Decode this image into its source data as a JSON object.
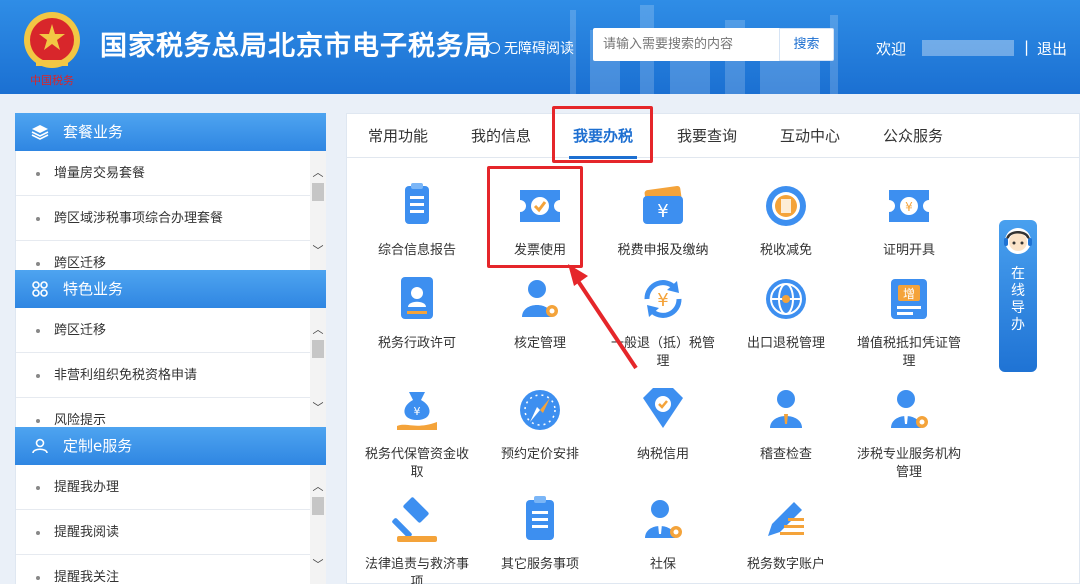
{
  "header": {
    "title": "国家税务总局北京市电子税务局",
    "emblem_caption": "中国税务",
    "accessible_label": "无障碍阅读",
    "search_placeholder": "请输入需要搜索的内容",
    "search_button": "搜索",
    "welcome": "欢迎",
    "separator": "|",
    "logout": "退出"
  },
  "sidebar": [
    {
      "title": "套餐业务",
      "icon": "layers-icon",
      "items": [
        "增量房交易套餐",
        "跨区域涉税事项综合办理套餐",
        "跨区迁移"
      ]
    },
    {
      "title": "特色业务",
      "icon": "grid-icon",
      "items": [
        "跨区迁移",
        "非营利组织免税资格申请",
        "风险提示"
      ]
    },
    {
      "title": "定制e服务",
      "icon": "user-icon",
      "items": [
        "提醒我办理",
        "提醒我阅读",
        "提醒我关注"
      ]
    }
  ],
  "tabs": [
    "常用功能",
    "我的信息",
    "我要办税",
    "我要查询",
    "互动中心",
    "公众服务"
  ],
  "active_tab": "我要办税",
  "services": [
    {
      "label": "综合信息报告",
      "icon": "document-list-icon"
    },
    {
      "label": "发票使用",
      "icon": "invoice-ticket-icon"
    },
    {
      "label": "税费申报及缴纳",
      "icon": "yuan-wallet-icon"
    },
    {
      "label": "税收减免",
      "icon": "tax-relief-icon"
    },
    {
      "label": "证明开具",
      "icon": "certificate-ticket-icon"
    },
    {
      "label": "税务行政许可",
      "icon": "id-card-icon"
    },
    {
      "label": "核定管理",
      "icon": "user-gear-icon"
    },
    {
      "label": "一般退（抵）税管理",
      "icon": "yuan-refresh-icon"
    },
    {
      "label": "出口退税管理",
      "icon": "globe-icon"
    },
    {
      "label": "增值税抵扣凭证管理",
      "icon": "vat-voucher-icon"
    },
    {
      "label": "税务代保管资金收取",
      "icon": "money-bag-hand-icon"
    },
    {
      "label": "预约定价安排",
      "icon": "compass-icon"
    },
    {
      "label": "纳税信用",
      "icon": "diamond-check-icon"
    },
    {
      "label": "稽查检查",
      "icon": "inspector-icon"
    },
    {
      "label": "涉税专业服务机构管理",
      "icon": "agent-gear-icon"
    },
    {
      "label": "法律追责与救济事项",
      "icon": "gavel-icon"
    },
    {
      "label": "其它服务事项",
      "icon": "clipboard-icon"
    },
    {
      "label": "社保",
      "icon": "social-security-icon"
    },
    {
      "label": "税务数字账户",
      "icon": "pen-lines-icon"
    }
  ],
  "guide": {
    "label": "在线导办"
  },
  "colors": {
    "brand_blue": "#1d6fd1",
    "highlight_red": "#e5262a"
  }
}
